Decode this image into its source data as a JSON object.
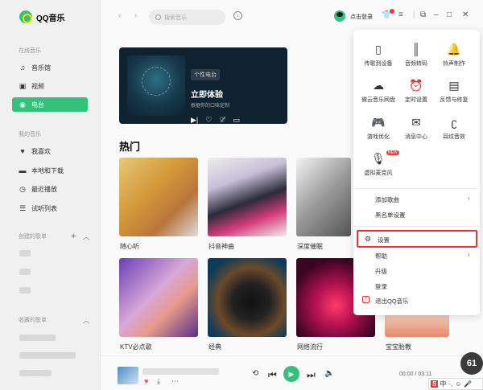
{
  "app": {
    "name": "QQ音乐"
  },
  "sidebar": {
    "online_title": "在线音乐",
    "online_items": [
      {
        "label": "音乐馆",
        "icon": "music-note-icon"
      },
      {
        "label": "视频",
        "icon": "video-icon"
      },
      {
        "label": "电台",
        "icon": "radio-icon"
      }
    ],
    "my_title": "我的音乐",
    "my_items": [
      {
        "label": "我喜欢",
        "icon": "heart-icon"
      },
      {
        "label": "本地和下载",
        "icon": "monitor-icon"
      },
      {
        "label": "最近播放",
        "icon": "clock-icon"
      },
      {
        "label": "试听列表",
        "icon": "playlist-icon"
      }
    ],
    "created_title": "创建的歌单",
    "collected_title": "收藏的歌单"
  },
  "topbar": {
    "search_placeholder": "搜索音乐",
    "login_label": "点击登录"
  },
  "radio": {
    "tag": "个性电台",
    "title": "立即体验",
    "subtitle": "根据你的口味定制"
  },
  "hot": {
    "title": "热门",
    "tiles": [
      "随心听",
      "抖音神曲",
      "深度催眠",
      "KTV必点歌",
      "经典",
      "网络流行",
      "宝宝胎教"
    ]
  },
  "menu": {
    "grid": [
      {
        "label": "传歌到设备",
        "icon": "phone-icon"
      },
      {
        "label": "音频转码",
        "icon": "audio-wave-icon"
      },
      {
        "label": "铃声制作",
        "icon": "bell-icon"
      },
      {
        "label": "微云音乐网盘",
        "icon": "cloud-icon"
      },
      {
        "label": "定时设置",
        "icon": "alarm-clock-icon"
      },
      {
        "label": "反馈与修复",
        "icon": "feedback-icon"
      },
      {
        "label": "游戏优化",
        "icon": "gamepad-icon"
      },
      {
        "label": "消息中心",
        "icon": "mail-icon"
      },
      {
        "label": "耳纹音效",
        "icon": "ear-icon"
      },
      {
        "label": "虚拟麦克风",
        "icon": "microphone-icon"
      }
    ],
    "new_badge": "NEW",
    "items": [
      "添加歌曲",
      "黑名单设置",
      "设置",
      "帮助",
      "升级",
      "登录",
      "退出QQ音乐"
    ]
  },
  "player": {
    "time": "00:00 / 03:11",
    "badge": "61"
  },
  "ime": {
    "brand": "S",
    "lang": "中"
  },
  "colors": {
    "accent": "#31c27c",
    "highlight": "#ee3333"
  }
}
